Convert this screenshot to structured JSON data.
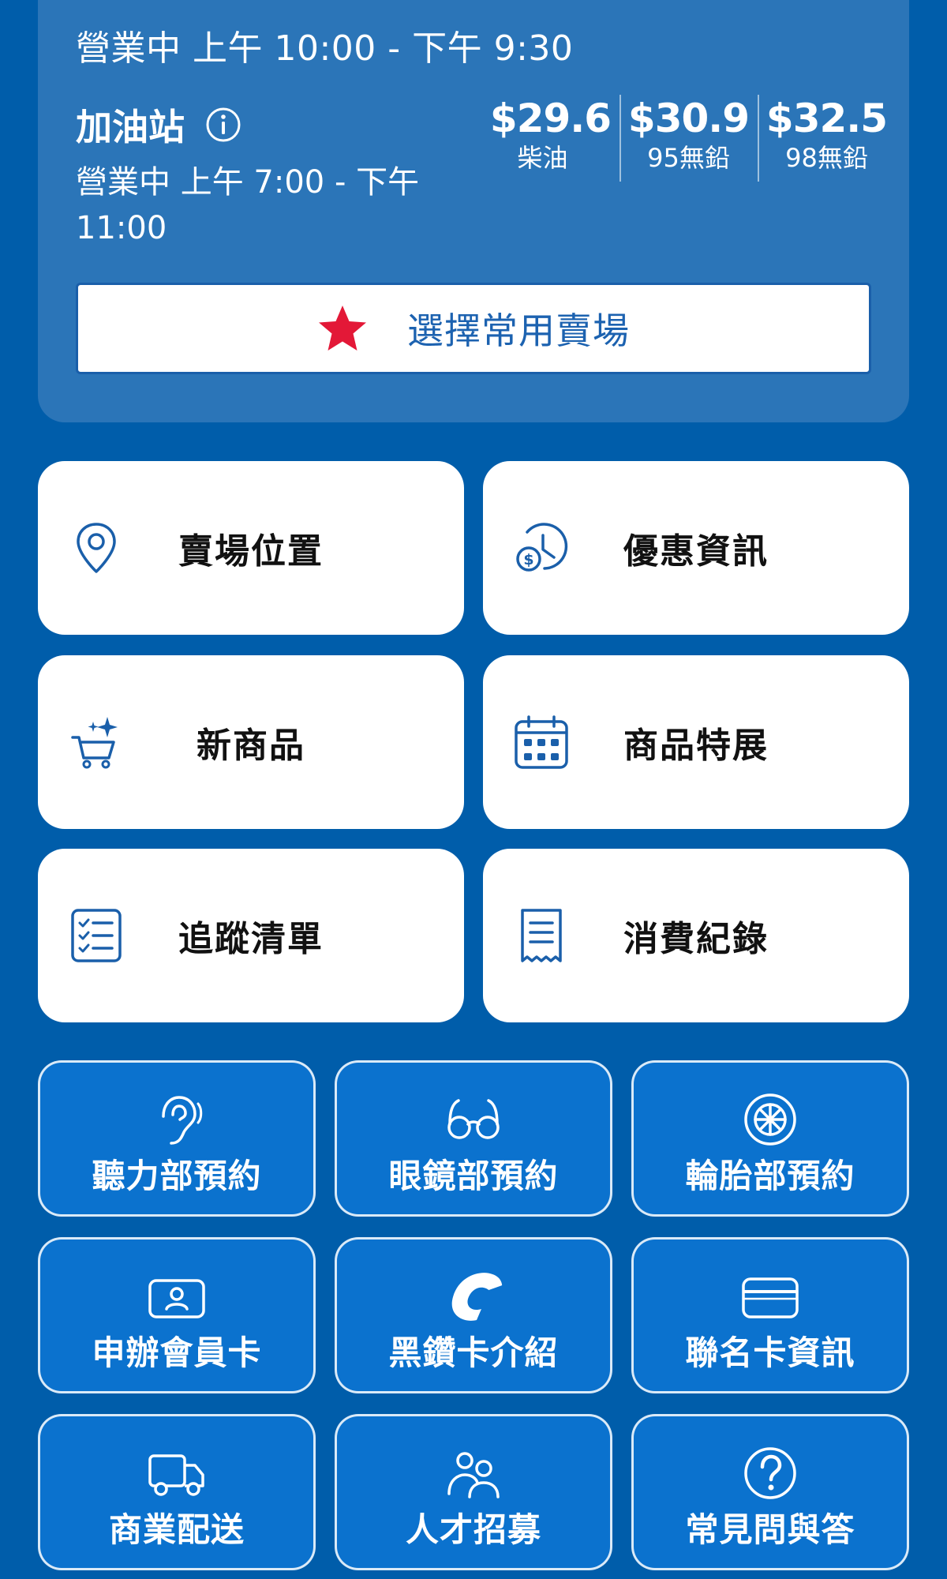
{
  "warehouse": {
    "hours": "營業中 上午 10:00 - 下午 9:30"
  },
  "gas_station": {
    "title": "加油站",
    "hours": "營業中 上午 7:00 - 下午 11:00",
    "prices": [
      {
        "amount": "$29.6",
        "grade": "柴油"
      },
      {
        "amount": "$30.9",
        "grade": "95無鉛"
      },
      {
        "amount": "$32.5",
        "grade": "98無鉛"
      }
    ]
  },
  "favorite_button": {
    "label": "選擇常用賣場",
    "icon": "star-icon",
    "color": "#e31837"
  },
  "tiles": [
    {
      "label": "賣場位置",
      "icon": "location-pin-icon"
    },
    {
      "label": "優惠資訊",
      "icon": "clock-dollar-icon"
    },
    {
      "label": "新商品",
      "icon": "sparkle-cart-icon"
    },
    {
      "label": "商品特展",
      "icon": "calendar-icon"
    },
    {
      "label": "追蹤清單",
      "icon": "checklist-icon"
    },
    {
      "label": "消費紀錄",
      "icon": "receipt-icon"
    }
  ],
  "services": [
    {
      "label": "聽力部預約",
      "icon": "ear-icon"
    },
    {
      "label": "眼鏡部預約",
      "icon": "glasses-icon"
    },
    {
      "label": "輪胎部預約",
      "icon": "tire-icon"
    },
    {
      "label": "申辦會員卡",
      "icon": "member-card-icon"
    },
    {
      "label": "黑鑽卡介紹",
      "icon": "costco-c-icon"
    },
    {
      "label": "聯名卡資訊",
      "icon": "credit-card-icon"
    },
    {
      "label": "商業配送",
      "icon": "delivery-truck-icon"
    },
    {
      "label": "人才招募",
      "icon": "people-icon"
    },
    {
      "label": "常見問與答",
      "icon": "question-icon"
    }
  ],
  "colors": {
    "background": "#005daa",
    "card": "#2b75b8",
    "service_button": "#0b72ce",
    "tile_icon": "#1a5faa"
  }
}
